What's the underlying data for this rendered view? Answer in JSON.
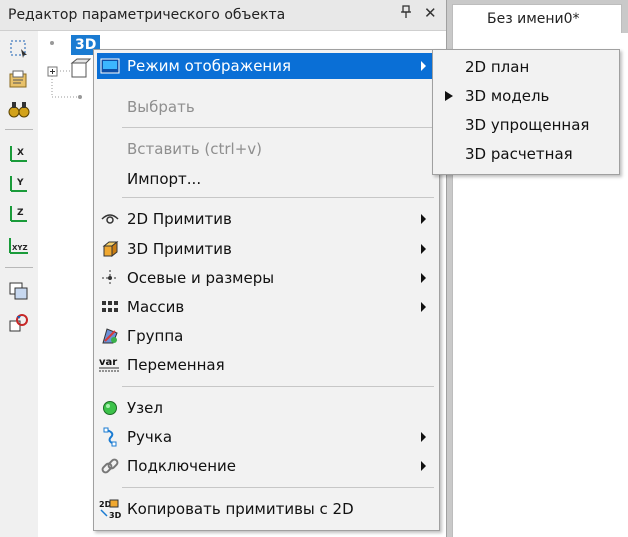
{
  "panel": {
    "title": "Редактор параметрического объекта",
    "pin_glyph": "ᵖ",
    "close_glyph": "✕"
  },
  "tree": {
    "root_label": "3D"
  },
  "right_tab": {
    "label": "Без имени0*"
  },
  "menu": {
    "items": [
      {
        "label": "Режим отображения",
        "icon": "display-mode-icon",
        "has_submenu": true,
        "highlighted": true
      },
      {
        "label": "Выбрать",
        "disabled": true
      },
      {
        "label": "Вставить (ctrl+v)",
        "disabled": true
      },
      {
        "label": "Импорт..."
      },
      {
        "label": "2D Примитив",
        "icon": "primitive-2d-icon",
        "has_submenu": true
      },
      {
        "label": "3D Примитив",
        "icon": "primitive-3d-icon",
        "has_submenu": true
      },
      {
        "label": "Осевые и размеры",
        "icon": "axes-dimensions-icon",
        "has_submenu": true
      },
      {
        "label": "Массив",
        "icon": "array-icon",
        "has_submenu": true
      },
      {
        "label": "Группа",
        "icon": "group-icon"
      },
      {
        "label": "Переменная",
        "icon": "variable-icon",
        "icon_text": "var"
      },
      {
        "label": "Узел",
        "icon": "node-icon"
      },
      {
        "label": "Ручка",
        "icon": "handle-icon",
        "has_submenu": true
      },
      {
        "label": "Подключение",
        "icon": "connection-icon",
        "has_submenu": true
      },
      {
        "label": "Копировать примитивы с 2D",
        "icon": "copy-2d-to-3d-icon",
        "icon_text_top": "2D",
        "icon_text_bottom": "3D"
      }
    ]
  },
  "submenu": {
    "items": [
      {
        "label": "2D план"
      },
      {
        "label": "3D модель",
        "checked": true
      },
      {
        "label": "3D упрощенная"
      },
      {
        "label": "3D расчетная"
      }
    ]
  },
  "toolbar": {
    "tool_labels": [
      "X",
      "Y",
      "Z",
      "XYZ"
    ]
  },
  "colors": {
    "highlight": "#0a6fd6",
    "tree_selection": "#1a7bd2"
  }
}
